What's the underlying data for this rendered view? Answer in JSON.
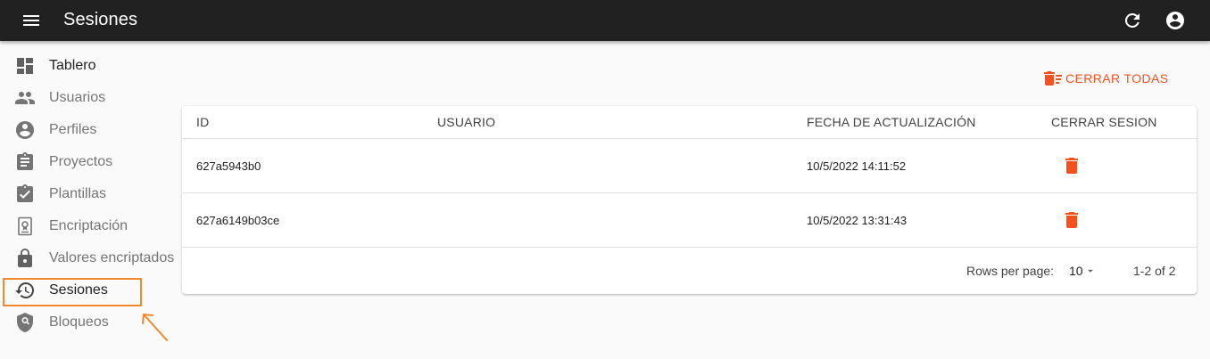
{
  "app": {
    "title": "Sesiones"
  },
  "sidebar": {
    "items": [
      {
        "label": "Tablero",
        "icon": "dashboard-icon"
      },
      {
        "label": "Usuarios",
        "icon": "users-icon"
      },
      {
        "label": "Perfiles",
        "icon": "account-circle-icon"
      },
      {
        "label": "Proyectos",
        "icon": "clipboard-icon"
      },
      {
        "label": "Plantillas",
        "icon": "clipboard-check-icon"
      },
      {
        "label": "Encriptación",
        "icon": "certificate-icon"
      },
      {
        "label": "Valores encriptados",
        "icon": "lock-icon"
      },
      {
        "label": "Sesiones",
        "icon": "history-icon"
      },
      {
        "label": "Bloqueos",
        "icon": "shield-search-icon"
      }
    ],
    "active": "Sesiones"
  },
  "actions": {
    "clear_all_label": "CERRAR TODAS"
  },
  "table": {
    "headers": {
      "id": "ID",
      "user": "USUARIO",
      "updated": "FECHA DE ACTUALIZACIÓN",
      "close": "CERRAR SESION"
    },
    "rows": [
      {
        "id": "627a5943b0",
        "user": "",
        "updated": "10/5/2022 14:11:52"
      },
      {
        "id": "627a6149b03ce",
        "user": "",
        "updated": "10/5/2022 13:31:43"
      }
    ],
    "footer": {
      "rows_per_page_label": "Rows per page:",
      "rows_per_page_value": "10",
      "pagination": "1-2 of 2"
    }
  },
  "colors": {
    "appbar": "#212121",
    "accent": "#f4511e",
    "highlight": "#f0882e"
  }
}
